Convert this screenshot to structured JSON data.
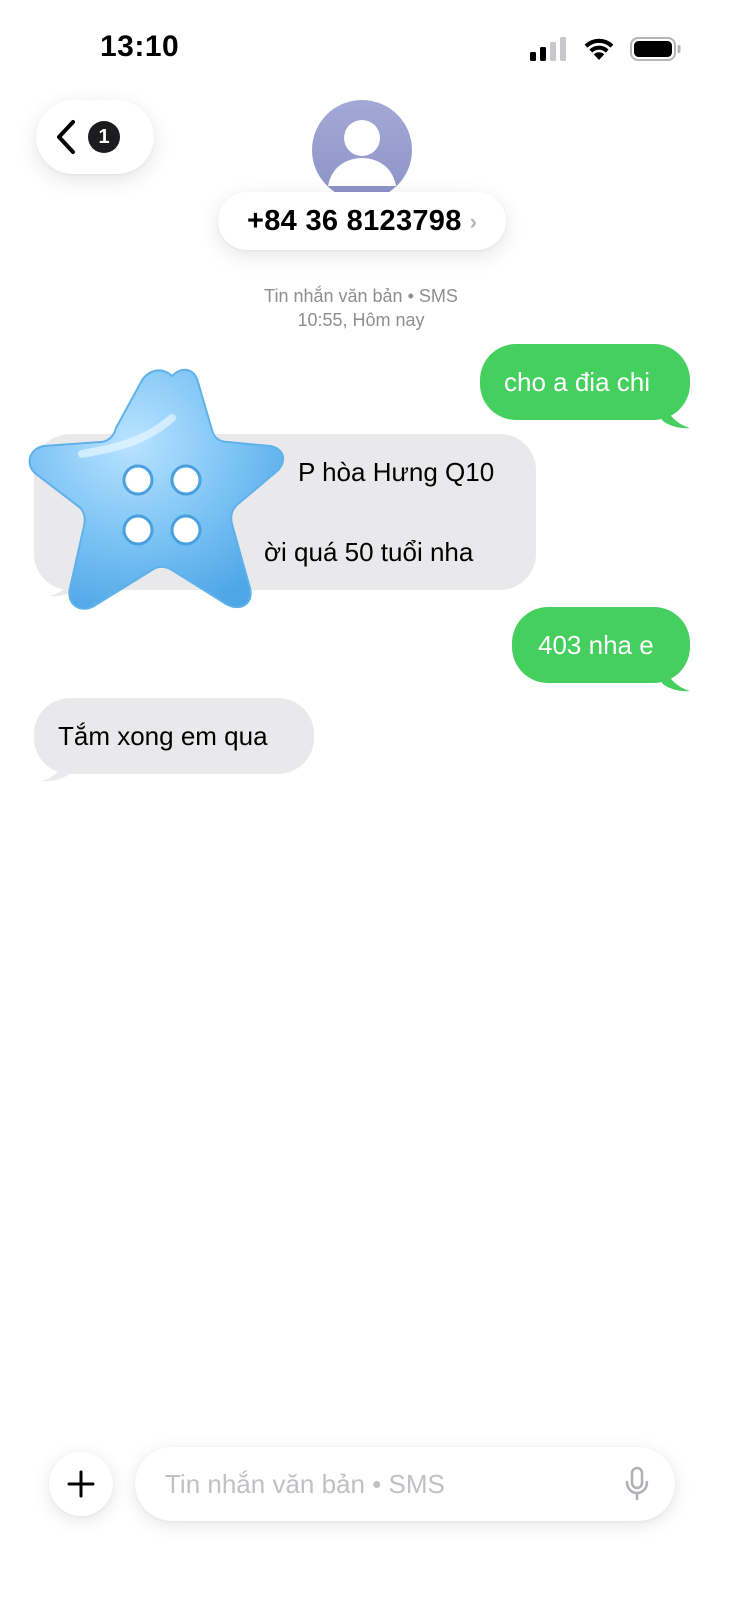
{
  "status_bar": {
    "time": "13:10"
  },
  "header": {
    "back_badge": "1",
    "contact_name": "+84 36 8123798",
    "contact_chevron": "›"
  },
  "thread_meta": {
    "type": "Tin nhắn văn bản • SMS",
    "timestamp": "10:55, Hôm nay"
  },
  "messages": [
    {
      "direction": "outgoing",
      "text": "cho a đia chi"
    },
    {
      "direction": "incoming",
      "lines": [
        "P hòa Hưng Q10",
        "",
        "ời quá 50 tuổi nha"
      ],
      "partially_covered_by": "blue-star-sticker"
    },
    {
      "direction": "outgoing",
      "text": "403 nha e"
    },
    {
      "direction": "incoming",
      "text": "Tắm xong em qua"
    }
  ],
  "composer": {
    "plus_icon": "plus-icon",
    "placeholder": "Tin nhắn văn bản • SMS",
    "value": "",
    "mic_icon": "microphone-icon"
  },
  "colors": {
    "outgoing_bubble": "#45cf5f",
    "incoming_bubble": "#e9e9eb",
    "meta_text": "#8e8e93",
    "avatar": "#9aa0d0",
    "sticker": "#7cc3f5"
  }
}
